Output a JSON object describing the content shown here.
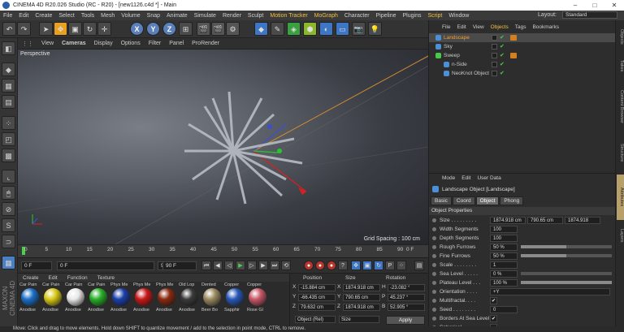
{
  "window": {
    "title": "CINEMA 4D R20.026 Studio (RC - R20) - [new1126.c4d *] - Main"
  },
  "menu": {
    "items": [
      "File",
      "Edit",
      "Create",
      "Select",
      "Tools",
      "Mesh",
      "Volume",
      "Snap",
      "Animate",
      "Simulate",
      "Render",
      "Sculpt",
      "Motion Tracker",
      "MoGraph",
      "Character",
      "Pipeline",
      "Plugins",
      "Script",
      "Window"
    ],
    "layout_label": "Layout:",
    "layout_value": "Standard"
  },
  "toolbar": {
    "axes": [
      "X",
      "Y",
      "Z"
    ]
  },
  "viewport": {
    "menu": [
      "View",
      "Cameras",
      "Display",
      "Options",
      "Filter",
      "Panel",
      "ProRender"
    ],
    "label": "Perspective",
    "grid_spacing": "Grid Spacing : 100 cm"
  },
  "timeline": {
    "ticks": [
      "0",
      "5",
      "10",
      "15",
      "20",
      "25",
      "30",
      "35",
      "40",
      "45",
      "50",
      "55",
      "60",
      "65",
      "70",
      "75",
      "80",
      "85",
      "90"
    ],
    "end_label": "0 F"
  },
  "playback": {
    "start": "0 F",
    "current": "0 F",
    "end_field": "90 F",
    "end": "90 F"
  },
  "materials": {
    "menu": [
      "Create",
      "Edit",
      "Function",
      "Texture"
    ],
    "items": [
      {
        "name": "Car Pain",
        "name2": "Anodise",
        "color": "#1c6fc8"
      },
      {
        "name": "Car Pain",
        "name2": "Anodise",
        "color": "#d8c818"
      },
      {
        "name": "Car Pain",
        "name2": "Anodise",
        "color": "#e8e8e8"
      },
      {
        "name": "Car Pain",
        "name2": "Anodise",
        "color": "#28b028"
      },
      {
        "name": "Phys Me",
        "name2": "Anodise",
        "color": "#1a3fa8"
      },
      {
        "name": "Phys Me",
        "name2": "Anodise",
        "color": "#c81818"
      },
      {
        "name": "Phys Me",
        "name2": "Anodise",
        "color": "#8a2a10"
      },
      {
        "name": "Old Lop",
        "name2": "Anodise",
        "color": "#3a3a3a"
      },
      {
        "name": "Dented",
        "name2": "Beer Bo",
        "color": "#9a8a60"
      },
      {
        "name": "Copper",
        "name2": "Sapphir",
        "color": "#2858b8"
      },
      {
        "name": "Copper",
        "name2": "Rose Gl",
        "color": "#c85868"
      }
    ]
  },
  "coordinates": {
    "headers": [
      "Position",
      "Size",
      "Rotation"
    ],
    "rows": [
      {
        "axis": "X",
        "pos": "-15.884 cm",
        "size_axis": "X",
        "size": "1874.918 cm",
        "rot_axis": "H",
        "rot": "-23.082 °"
      },
      {
        "axis": "Y",
        "pos": "-66.435 cm",
        "size_axis": "Y",
        "size": "790.65 cm",
        "rot_axis": "P",
        "rot": "45.237 °"
      },
      {
        "axis": "Z",
        "pos": "79.632 cm",
        "size_axis": "Z",
        "size": "1874.918 cm",
        "rot_axis": "B",
        "rot": "52.905 °"
      }
    ],
    "mode": "Object (Rel)",
    "size_mode": "Size",
    "apply": "Apply"
  },
  "objects": {
    "menu": [
      "File",
      "Edit",
      "View",
      "Objects",
      "Tags",
      "Bookmarks"
    ],
    "active_menu": "Objects",
    "items": [
      {
        "name": "Landscape",
        "color": "#4a90d8",
        "text_color": "#f0a030"
      },
      {
        "name": "Sky",
        "color": "#4a90d8",
        "text_color": "#c8c8c8"
      },
      {
        "name": "Sweep",
        "color": "#4ac848",
        "text_color": "#c8c8c8"
      },
      {
        "name": "n-Side",
        "color": "#4a90d8",
        "text_color": "#c8c8c8"
      },
      {
        "name": "NeoKnot Object",
        "color": "#4a90d8",
        "text_color": "#c8c8c8"
      }
    ]
  },
  "attributes": {
    "menu": [
      "Mode",
      "Edit",
      "User Data"
    ],
    "title": "Landscape Object [Landscape]",
    "tabs": [
      "Basic",
      "Coord",
      "Object",
      "Phong"
    ],
    "active_tab": "Object",
    "section": "Object Properties",
    "props": [
      {
        "label": "Size . . . . . . . . .",
        "v1": "1874.918 cm",
        "v2": "790.65 cm",
        "v3": "1874.918"
      },
      {
        "label": "Width Segments",
        "v1": "100"
      },
      {
        "label": "Depth Segments",
        "v1": "100"
      },
      {
        "label": "Rough Furrows",
        "v1": "50 %",
        "bar": 0.5
      },
      {
        "label": "Fine Furrows",
        "v1": "50 %",
        "bar": 0.5
      },
      {
        "label": "Scale . . . . . . . .",
        "v1": "1"
      },
      {
        "label": "Sea Level . . . . .",
        "v1": "0 %",
        "bar": 0.0
      },
      {
        "label": "Plateau Level . . .",
        "v1": "100 %",
        "bar": 1.0
      },
      {
        "label": "Orientation . . . .",
        "v1": "+Y"
      },
      {
        "label": "Multifractal. . . .",
        "check": "✔"
      },
      {
        "label": "Seed . . . . . . . .",
        "v1": "0"
      },
      {
        "label": "Borders At Sea Level",
        "check": "✔"
      },
      {
        "label": "Spherical. . . . . .",
        "check": ""
      }
    ]
  },
  "sidetabs": [
    "Objects",
    "Takes",
    "Content Browser",
    "Structure",
    "Attributes",
    "Layers"
  ],
  "status": {
    "text": "Move: Click and drag to move elements. Hold down SHIFT to quantize movement / add to the selection in point mode, CTRL to remove."
  }
}
